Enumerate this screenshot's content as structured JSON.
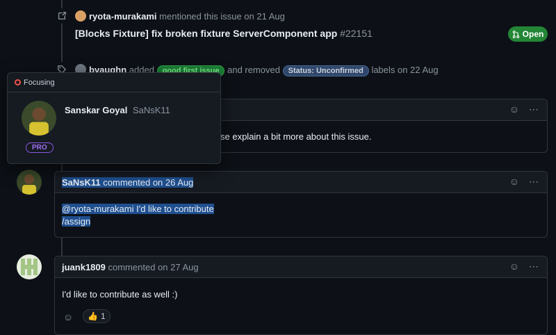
{
  "mention_event": {
    "user": "ryota-murakami",
    "action": "mentioned this issue on 21 Aug",
    "ref_title": "[Blocks Fixture] fix broken fixture ServerComponent app",
    "ref_number": "#22151",
    "state": "Open"
  },
  "label_event": {
    "user": "bvaughn",
    "added": "added",
    "label_added": "good first issue",
    "and_removed": "and removed",
    "label_removed": "Status: Unconfirmed",
    "suffix": "labels on 22 Aug"
  },
  "hover_card": {
    "status": "Focusing",
    "name": "Sanskar Goyal",
    "username": "SaNsK11",
    "badge": "PRO"
  },
  "comment_hidden": {
    "body_fragment": "se explain a bit more about this issue."
  },
  "comment_sansk": {
    "author": "SaNsK11",
    "meta": "commented on 26 Aug",
    "line1": "@ryota-murakami I'd like to contribute",
    "line2": "/assign"
  },
  "comment_juank": {
    "author": "juank1809",
    "meta": "commented on 27 Aug",
    "body": "I'd like to contribute as well :)",
    "reaction_count": "1"
  },
  "icons": {
    "more": "⋯",
    "smiley": "☺",
    "thumbs": "👍"
  },
  "colors": {
    "open_green": "#238636",
    "good_first_issue": "#7ee787",
    "unconfirmed": "#30476b",
    "selection": "#1f4f8f"
  }
}
